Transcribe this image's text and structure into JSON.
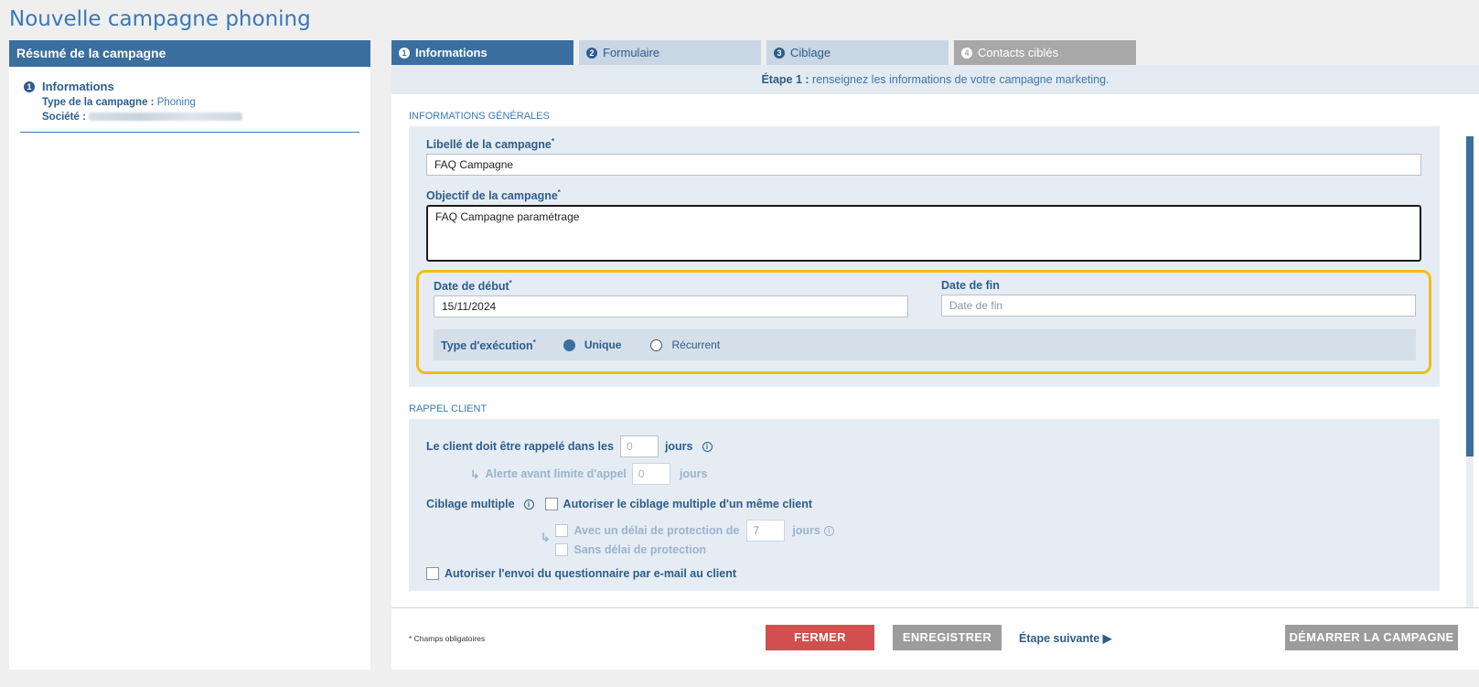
{
  "page_title": "Nouvelle campagne phoning",
  "summary": {
    "header": "Résumé de la campagne",
    "section_num": "1",
    "section_title": "Informations",
    "type_label": "Type de la campagne :",
    "type_value": "Phoning",
    "company_label": "Société :"
  },
  "tabs": [
    {
      "num": "1",
      "label": "Informations"
    },
    {
      "num": "2",
      "label": "Formulaire"
    },
    {
      "num": "3",
      "label": "Ciblage"
    },
    {
      "num": "4",
      "label": "Contacts ciblés"
    }
  ],
  "step": {
    "bold": "Étape 1 :",
    "text": " renseignez les informations de votre campagne marketing."
  },
  "general": {
    "section_label": "INFORMATIONS GÉNÉRALES",
    "libelle_label": "Libellé de la campagne",
    "libelle_value": "FAQ Campagne",
    "objectif_label": "Objectif de la campagne",
    "objectif_value": "FAQ Campagne paramétrage",
    "date_debut_label": "Date de début",
    "date_debut_value": "15/11/2024",
    "date_fin_label": "Date de fin",
    "date_fin_placeholder": "Date de fin",
    "required_mark": "*",
    "exec_label": "Type d'exécution",
    "exec_options": [
      {
        "label": "Unique",
        "selected": true
      },
      {
        "label": "Récurrent",
        "selected": false
      }
    ]
  },
  "rappel": {
    "section_label": "RAPPEL CLIENT",
    "rappel_text": "Le client doit être rappelé dans les",
    "rappel_placeholder": "0",
    "jours": "jours",
    "alerte_text": "Alerte avant limite d'appel",
    "alerte_placeholder": "0",
    "ciblage_label": "Ciblage multiple",
    "ciblage_checkbox": "Autoriser le ciblage multiple d'un même client",
    "delai_text": "Avec un délai de protection de",
    "delai_value": "7",
    "sans_delai": "Sans délai de protection",
    "questionnaire": "Autoriser l'envoi du questionnaire par e-mail au client"
  },
  "footer": {
    "note": "* Champs obligatoires",
    "fermer": "FERMER",
    "enregistrer": "ENREGISTRER",
    "suivante": "Étape suivante",
    "demarrer": "DÉMARRER LA CAMPAGNE"
  },
  "colors": {
    "accent": "#3a6f9f",
    "danger": "#d24f4f",
    "highlight": "#f0bd1b",
    "disabled": "#9c9c9c"
  }
}
